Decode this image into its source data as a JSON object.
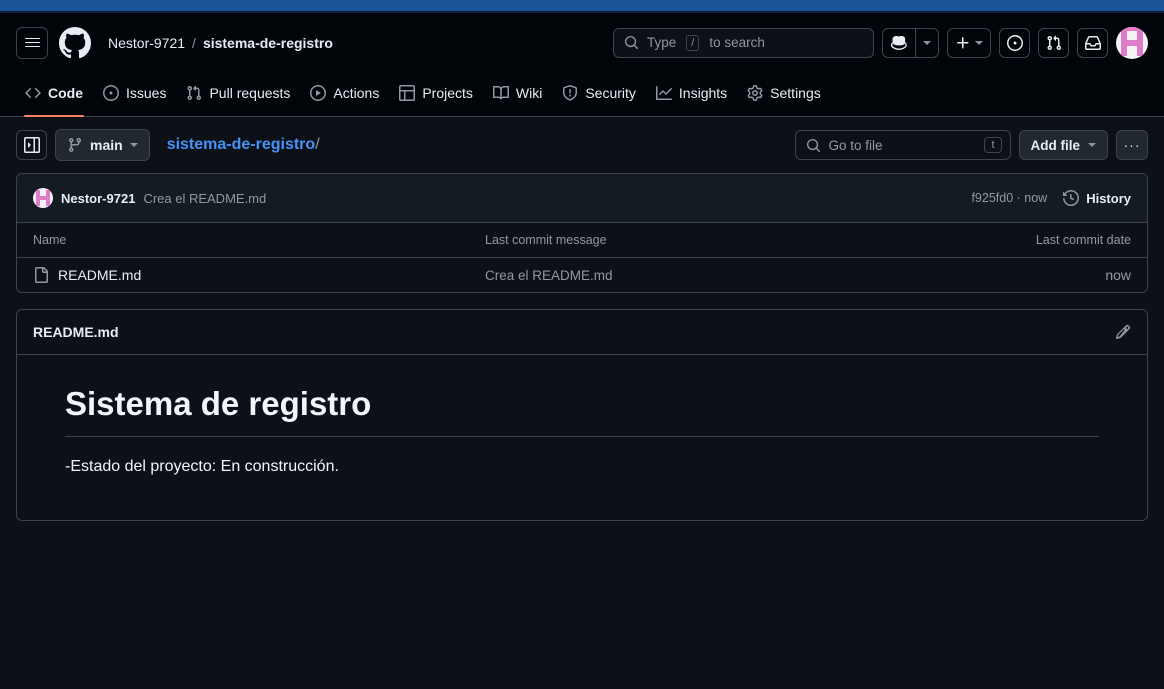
{
  "browser": {
    "accent_color": "#1a5396"
  },
  "header": {
    "menu_label": "Open navigation menu",
    "logo_name": "github-logo",
    "owner": "Nestor-9721",
    "separator": "/",
    "repo": "sistema-de-registro",
    "search": {
      "prefix": "Type",
      "key": "/",
      "suffix": "to search",
      "placeholder": "Type / to search"
    },
    "copilot_label": "Copilot",
    "create_new_label": "Create new...",
    "issues_label": "Your issues",
    "pull_requests_label": "Your pull requests",
    "inbox_label": "Notifications",
    "avatar_label": "Nestor-9721"
  },
  "repo_nav": {
    "tabs": [
      {
        "label": "Code",
        "icon": "code-icon",
        "active": true
      },
      {
        "label": "Issues",
        "icon": "issue-opened-icon",
        "active": false
      },
      {
        "label": "Pull requests",
        "icon": "git-pull-request-icon",
        "active": false
      },
      {
        "label": "Actions",
        "icon": "play-icon",
        "active": false
      },
      {
        "label": "Projects",
        "icon": "table-icon",
        "active": false
      },
      {
        "label": "Wiki",
        "icon": "book-icon",
        "active": false
      },
      {
        "label": "Security",
        "icon": "shield-icon",
        "active": false
      },
      {
        "label": "Insights",
        "icon": "graph-icon",
        "active": false
      },
      {
        "label": "Settings",
        "icon": "gear-icon",
        "active": false
      }
    ],
    "active_color": "#f78166"
  },
  "file_nav": {
    "sidebar_toggle_label": "Toggle file tree",
    "branch": "main",
    "breadcrumb_repo": "sistema-de-registro",
    "breadcrumb_slash": "/",
    "go_to_file_placeholder": "Go to file",
    "go_to_file_key": "t",
    "add_file_label": "Add file",
    "more_options_label": "···"
  },
  "latest_commit": {
    "author": "Nestor-9721",
    "message": "Crea el README.md",
    "sha": "f925fd0",
    "separator": "·",
    "time": "now",
    "meta": "f925fd0 · now",
    "history_label": "History"
  },
  "files_table": {
    "headers": {
      "name": "Name",
      "message": "Last commit message",
      "date": "Last commit date"
    },
    "rows": [
      {
        "icon": "file-icon",
        "name": "README.md",
        "message": "Crea el README.md",
        "date": "now"
      }
    ]
  },
  "readme": {
    "title": "README.md",
    "edit_label": "Edit README",
    "heading": "Sistema de registro",
    "body": "-Estado del proyecto: En construcción."
  }
}
